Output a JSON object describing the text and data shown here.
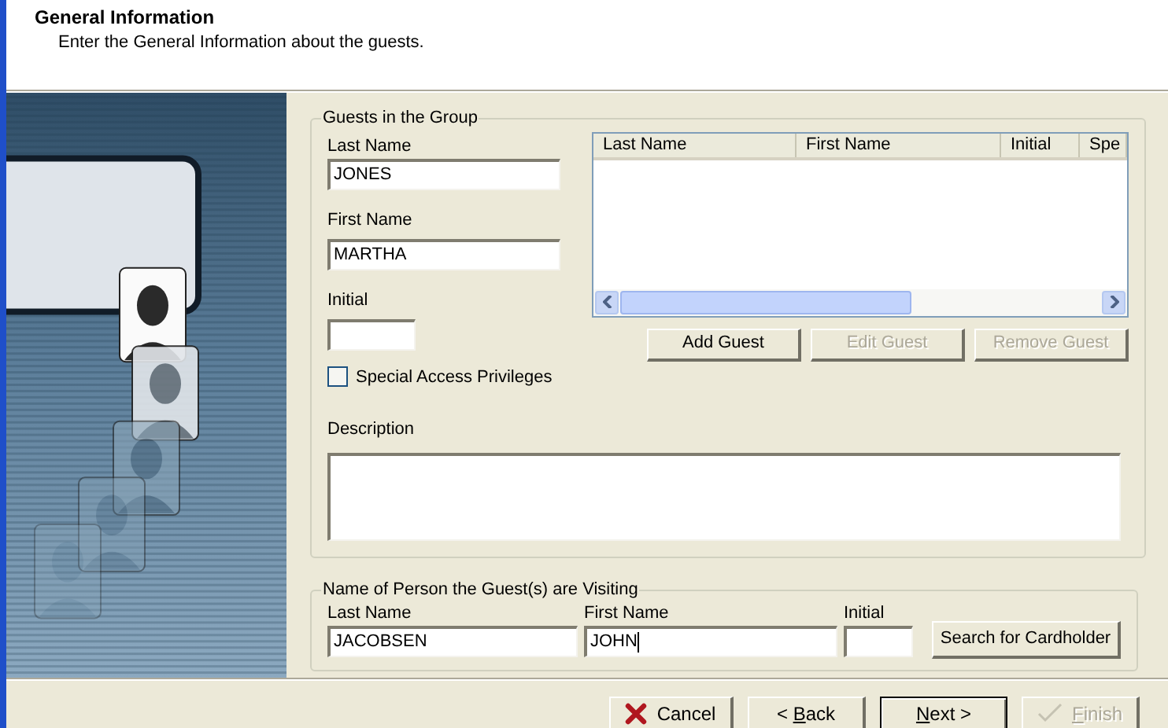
{
  "header": {
    "title": "General Information",
    "subtitle": "Enter the General Information about the guests."
  },
  "guests_group": {
    "legend": "Guests in the Group",
    "last_name": {
      "label": "Last Name",
      "value": "JONES"
    },
    "first_name": {
      "label": "First Name",
      "value": "MARTHA"
    },
    "initial": {
      "label": "Initial"
    },
    "special_access": {
      "label": "Special Access Privileges",
      "checked": false
    },
    "table": {
      "columns": [
        "Last Name",
        "First Name",
        "Initial",
        "Spe"
      ]
    },
    "buttons": [
      {
        "label": "Add Guest",
        "disabled": false
      },
      {
        "label": "Edit Guest",
        "disabled": true
      },
      {
        "label": "Remove Guest",
        "disabled": true
      }
    ],
    "description": {
      "label": "Description"
    }
  },
  "visiting_group": {
    "legend": "Name of Person the Guest(s) are Visiting",
    "last_name": {
      "label": "Last Name",
      "value": "JACOBSEN",
      "focused": false
    },
    "first_name": {
      "label": "First Name",
      "value": "JOHN",
      "focused": true
    },
    "initial": {
      "label": "Initial"
    },
    "search_button": {
      "label": "Search for Cardholder"
    }
  },
  "footer_buttons": [
    {
      "kind": "cancel",
      "label": "Cancel",
      "disabled": false,
      "default": false
    },
    {
      "kind": "back",
      "prefix": "< ",
      "access_key": "B",
      "suffix": "ack",
      "disabled": false,
      "default": false
    },
    {
      "kind": "next",
      "access_key": "N",
      "suffix": "ext >",
      "disabled": false,
      "default": true
    },
    {
      "kind": "finish",
      "access_key": "F",
      "suffix": "inish",
      "disabled": true,
      "default": false
    }
  ]
}
